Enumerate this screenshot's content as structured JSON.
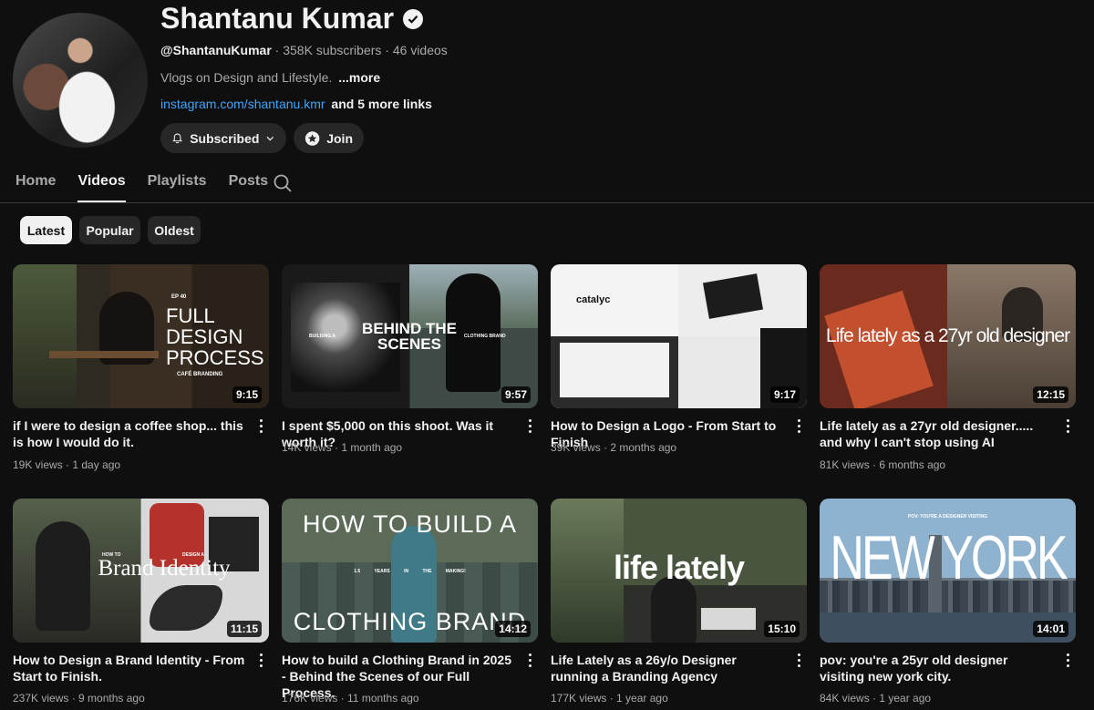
{
  "channel": {
    "name": "Shantanu Kumar",
    "handle": "@ShantanuKumar",
    "subscribers": "358K subscribers",
    "videos_count": "46 videos",
    "description": "Vlogs on Design and Lifestyle.",
    "more_label": "...more",
    "link_text": "instagram.com/shantanu.kmr",
    "more_links": "and 5 more links",
    "subscribed_label": "Subscribed",
    "join_label": "Join"
  },
  "tabs": [
    "Home",
    "Videos",
    "Playlists",
    "Posts"
  ],
  "active_tab": "Videos",
  "chips": [
    "Latest",
    "Popular",
    "Oldest"
  ],
  "selected_chip": "Latest",
  "videos": [
    {
      "title": "if I were to design a coffee shop... this is how I would do it.",
      "views": "19K views",
      "age": "1 day ago",
      "duration": "9:15",
      "thumb_text": "FULL DESIGN PROCESS",
      "thumb_sub": "EP 40",
      "thumb_caption": "CAFÉ BRANDING"
    },
    {
      "title": "I spent $5,000 on this shoot. Was it worth it?",
      "views": "14K views",
      "age": "1 month ago",
      "duration": "9:57",
      "thumb_text": "BEHIND THE SCENES",
      "thumb_left": "BUILDING A",
      "thumb_right": "CLOTHING BRAND"
    },
    {
      "title": "How to Design a Logo - From Start to Finish",
      "views": "39K views",
      "age": "2 months ago",
      "duration": "9:17",
      "thumb_text": "catalyc"
    },
    {
      "title": "Life lately as a 27yr old designer..... and why I can't stop using AI",
      "views": "81K views",
      "age": "6 months ago",
      "duration": "12:15",
      "thumb_text": "Life lately as a 27yr old designer"
    },
    {
      "title": "How to Design a Brand Identity - From Start to Finish.",
      "views": "237K views",
      "age": "9 months ago",
      "duration": "11:15",
      "thumb_text": "Brand Identity",
      "thumb_left": "HOW TO",
      "thumb_right": "DESIGN A"
    },
    {
      "title": "How to build a Clothing Brand in 2025 - Behind the Scenes of our Full Process.",
      "views": "176K views",
      "age": "11 months ago",
      "duration": "14:12",
      "thumb_text": "HOW TO BUILD A",
      "thumb_text2": "CLOTHING BRAND",
      "thumb_sub": "1.5 YEARS IN THE MAKING!"
    },
    {
      "title": "Life Lately as a 26y/o Designer running a Branding Agency",
      "views": "177K views",
      "age": "1 year ago",
      "duration": "15:10",
      "thumb_text": "life lately"
    },
    {
      "title": "pov: you're a 25yr old designer visiting new york city.",
      "views": "84K views",
      "age": "1 year ago",
      "duration": "14:01",
      "thumb_text": "NEW YORK",
      "thumb_sub": "POV: YOU'RE A DESIGNER VISITING"
    }
  ]
}
